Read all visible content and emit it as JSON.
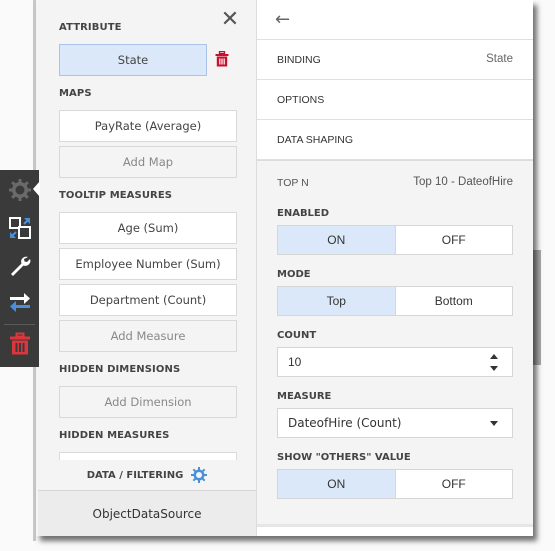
{
  "left_panel": {
    "close_icon": "close-icon",
    "sections": {
      "attribute": {
        "label": "ATTRIBUTE",
        "item": "State",
        "remove_icon": "trash-icon"
      },
      "maps": {
        "label": "MAPS",
        "items": [
          "PayRate (Average)"
        ],
        "add_label": "Add Map"
      },
      "tooltip_measures": {
        "label": "TOOLTIP MEASURES",
        "items": [
          "Age (Sum)",
          "Employee Number (Sum)",
          "Department (Count)"
        ],
        "add_label": "Add Measure"
      },
      "hidden_dimensions": {
        "label": "HIDDEN DIMENSIONS",
        "add_label": "Add Dimension"
      },
      "hidden_measures": {
        "label": "HIDDEN MEASURES"
      }
    },
    "data_filtering": {
      "label": "DATA / FILTERING",
      "icon": "gear-icon"
    },
    "data_source": "ObjectDataSource"
  },
  "toolbar": {
    "items": [
      {
        "name": "properties",
        "icon": "gear-icon",
        "active": true
      },
      {
        "name": "convert",
        "icon": "convert-icon"
      },
      {
        "name": "options",
        "icon": "wrench-icon"
      },
      {
        "name": "interactivity",
        "icon": "swap-arrows-icon"
      },
      {
        "name": "delete",
        "icon": "trash-icon"
      }
    ]
  },
  "right_panel": {
    "back_icon": "back-arrow-icon",
    "menu": [
      {
        "label": "BINDING",
        "value": "State"
      },
      {
        "label": "OPTIONS",
        "value": ""
      },
      {
        "label": "DATA SHAPING",
        "value": ""
      }
    ],
    "top_n": {
      "label": "TOP N",
      "value": "Top 10 - DateofHire",
      "enabled": {
        "label": "ENABLED",
        "options": [
          "ON",
          "OFF"
        ],
        "selected": "ON"
      },
      "mode": {
        "label": "MODE",
        "options": [
          "Top",
          "Bottom"
        ],
        "selected": "Top"
      },
      "count": {
        "label": "COUNT",
        "value": "10"
      },
      "measure": {
        "label": "MEASURE",
        "value": "DateofHire (Count)"
      },
      "show_others": {
        "label": "SHOW \"OTHERS\" VALUE",
        "options": [
          "ON",
          "OFF"
        ],
        "selected": "ON"
      }
    }
  },
  "colors": {
    "accent": "#4a90d9",
    "selected_bg": "#dbe8f9",
    "toolbar_bg": "#3a3a3a",
    "danger": "#d9363e"
  }
}
